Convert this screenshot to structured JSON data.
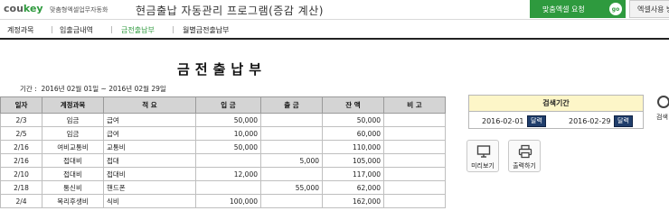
{
  "header": {
    "logo_part1": "cou",
    "logo_part2": "key",
    "logo_sub": "맞춤형엑셀업무자동화",
    "app_title": "현금출납 자동관리 프로그램(증감 계산)",
    "custom_request_label": "맞춤엑셀 요청",
    "go_label": "go",
    "manual_label": "엑셀사용 방"
  },
  "nav": {
    "tabs": [
      {
        "label": "계정과목"
      },
      {
        "label": "입출금내역"
      },
      {
        "label": "금전출납부"
      },
      {
        "label": "월별금전출납부"
      }
    ],
    "separator": "|",
    "active_index": 2
  },
  "report": {
    "heading": "금전출납부",
    "period_label": "기간 :",
    "period_text": "2016년 02월 01일 ~ 2016년 02월 29일"
  },
  "table": {
    "columns": [
      "일자",
      "계정과목",
      "적 요",
      "입 금",
      "출 금",
      "잔 액",
      "비 고"
    ],
    "rows": [
      [
        "2/3",
        "임금",
        "급여",
        "50,000",
        "",
        "50,000",
        ""
      ],
      [
        "2/5",
        "임금",
        "급여",
        "10,000",
        "",
        "60,000",
        ""
      ],
      [
        "2/16",
        "여비교통비",
        "교통비",
        "50,000",
        "",
        "110,000",
        ""
      ],
      [
        "2/16",
        "접대비",
        "접대",
        "",
        "5,000",
        "105,000",
        ""
      ],
      [
        "2/10",
        "접대비",
        "접대비",
        "12,000",
        "",
        "117,000",
        ""
      ],
      [
        "2/18",
        "통신비",
        "핸드폰",
        "",
        "55,000",
        "62,000",
        ""
      ],
      [
        "2/4",
        "복리후생비",
        "식비",
        "100,000",
        "",
        "162,000",
        ""
      ]
    ]
  },
  "search": {
    "title": "검색기간",
    "start_date": "2016-02-01",
    "end_date": "2016-02-29",
    "calendar_label": "달력",
    "search_button_label": "검색"
  },
  "tools": {
    "preview_label": "미리보기",
    "print_label": "출력하기"
  },
  "colors": {
    "brand_green": "#2e9a3e",
    "calendar_button": "#1f3d6b",
    "search_header": "#fdf6c8",
    "table_header": "#d4d4d4"
  }
}
